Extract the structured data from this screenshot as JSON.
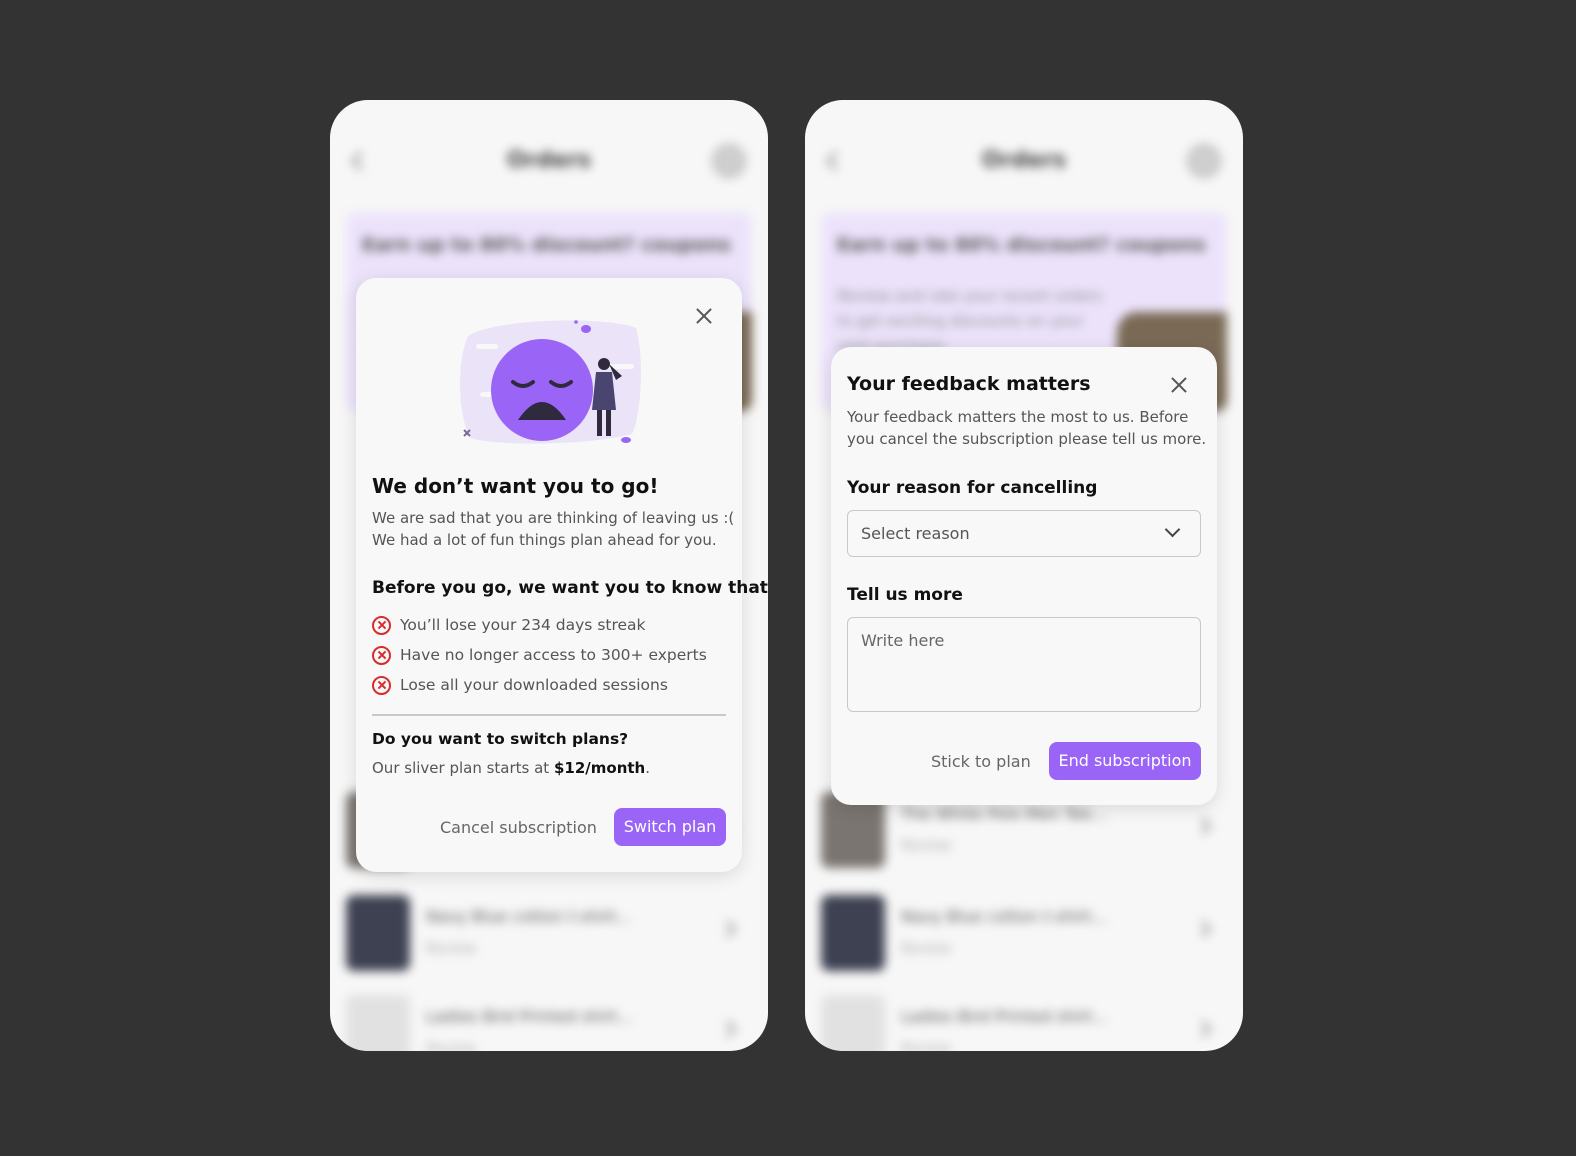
{
  "background_screen": {
    "title": "Orders",
    "banner_title": "Earn up to 80% discount? coupons",
    "banner_text": "Review and rate your recent orders to get exciting discounts on your next purchase.",
    "items": [
      {
        "title": "The White Polo Men Tee...",
        "status": "Review"
      },
      {
        "title": "Navy Blue cotton t-shirt...",
        "status": "Review"
      },
      {
        "title": "Ladies Bird Printed shirt...",
        "status": "Review"
      }
    ]
  },
  "retention_dialog": {
    "title": "We don’t want you to go!",
    "message_line1": "We are sad that you are thinking of leaving us :(",
    "message_line2": "We had a lot of fun things plan ahead for you.",
    "losses_heading": "Before you go, we want you to know that",
    "losses": [
      "You’ll lose your 234 days streak",
      "Have no longer access to 300+ experts",
      "Lose all your downloaded sessions"
    ],
    "switch_heading": "Do you want to switch plans?",
    "switch_text_prefix": "Our sliver plan starts at ",
    "switch_price": "$12/month",
    "switch_text_suffix": ".",
    "cancel_label": "Cancel subscription",
    "switch_label": "Switch plan"
  },
  "feedback_dialog": {
    "title": "Your feedback matters",
    "message_line1": "Your feedback matters the most to us. Before",
    "message_line2": "you cancel the subscription please tell us more.",
    "reason_label": "Your reason for cancelling",
    "reason_select_value": "Select reason",
    "more_label": "Tell us more",
    "more_placeholder": "Write here",
    "stick_label": "Stick to plan",
    "end_label": "End subscription"
  },
  "colors": {
    "accent": "#9a64f6",
    "danger": "#d62c2c",
    "canvas": "#333333"
  }
}
